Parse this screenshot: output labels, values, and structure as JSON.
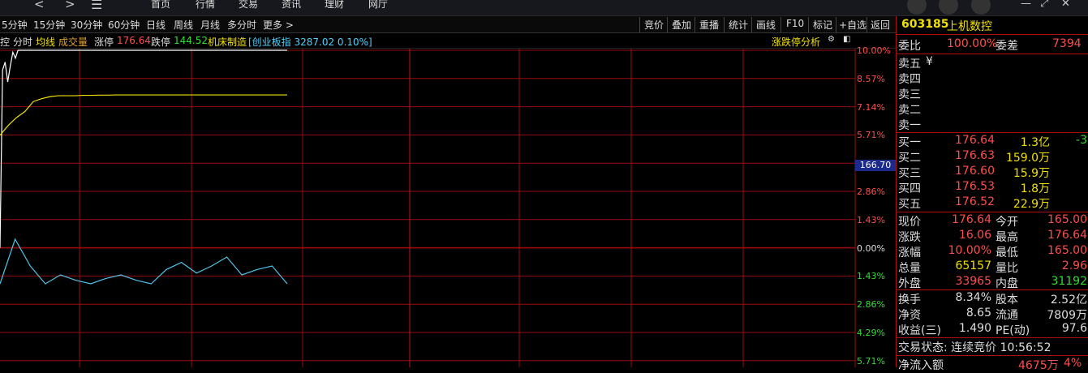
{
  "nav": {
    "back": "<",
    "forward": ">",
    "menu_icon": "menu-icon",
    "items": [
      "首页",
      "行情",
      "交易",
      "资讯",
      "理财",
      "网厅"
    ]
  },
  "periods": [
    "5分钟",
    "15分钟",
    "30分钟",
    "60分钟",
    "日线",
    "周线",
    "月线",
    "多分时",
    "更多 >"
  ],
  "tools": [
    "竞价",
    "叠加",
    "重播",
    "统计",
    "画线",
    "F10",
    "标记",
    "+自选",
    "返回"
  ],
  "subbar": {
    "prefix": "控",
    "fenshi": "分时",
    "avg": "均线",
    "vol": "成交量",
    "zt_label": "涨停",
    "zt_val": "176.64",
    "dt_label": "跌停",
    "dt_val": "144.52",
    "sector": "机床制造",
    "index_text": "[创业板指 3287.02 0.10%]",
    "analysis": "涨跌停分析"
  },
  "yaxis": [
    {
      "label": "10.00%",
      "color": "red"
    },
    {
      "label": "8.57%",
      "color": "red"
    },
    {
      "label": "7.14%",
      "color": "red"
    },
    {
      "label": "5.71%",
      "color": "red"
    },
    {
      "label": "",
      "color": "red"
    },
    {
      "label": "2.86%",
      "color": "red"
    },
    {
      "label": "1.43%",
      "color": "red"
    },
    {
      "label": "0.00%",
      "color": "white"
    },
    {
      "label": "1.43%",
      "color": "green"
    },
    {
      "label": "2.86%",
      "color": "green"
    },
    {
      "label": "4.29%",
      "color": "green"
    },
    {
      "label": "5.71%",
      "color": "green"
    }
  ],
  "current_price_tag": "166.70",
  "stock": {
    "code": "603185",
    "name": "上机数控"
  },
  "weibi": {
    "label": "委比",
    "value": "100.00%",
    "label2": "委差",
    "value2": "7394"
  },
  "asks": [
    {
      "label": "卖五",
      "price": "¥",
      "vol": ""
    },
    {
      "label": "卖四",
      "price": "",
      "vol": ""
    },
    {
      "label": "卖三",
      "price": "",
      "vol": ""
    },
    {
      "label": "卖二",
      "price": "",
      "vol": ""
    },
    {
      "label": "卖一",
      "price": "",
      "vol": ""
    }
  ],
  "bids": [
    {
      "label": "买一",
      "price": "176.64",
      "vol": "1.3亿",
      "extra": "-3"
    },
    {
      "label": "买二",
      "price": "176.63",
      "vol": "159.0万",
      "extra": ""
    },
    {
      "label": "买三",
      "price": "176.60",
      "vol": "15.9万",
      "extra": ""
    },
    {
      "label": "买四",
      "price": "176.53",
      "vol": "1.8万",
      "extra": ""
    },
    {
      "label": "买五",
      "price": "176.52",
      "vol": "22.9万",
      "extra": ""
    }
  ],
  "stats1": [
    {
      "l1": "现价",
      "v1": "176.64",
      "c1": "red",
      "l2": "今开",
      "v2": "165.00",
      "c2": "red"
    },
    {
      "l1": "涨跌",
      "v1": "16.06",
      "c1": "red",
      "l2": "最高",
      "v2": "176.64",
      "c2": "red"
    },
    {
      "l1": "涨幅",
      "v1": "10.00%",
      "c1": "red",
      "l2": "最低",
      "v2": "165.00",
      "c2": "red"
    },
    {
      "l1": "总量",
      "v1": "65157",
      "c1": "yel",
      "l2": "量比",
      "v2": "2.96",
      "c2": "red"
    },
    {
      "l1": "外盘",
      "v1": "33965",
      "c1": "red",
      "l2": "内盘",
      "v2": "31192",
      "c2": "grn"
    }
  ],
  "stats2": [
    {
      "l1": "换手",
      "v1": "8.34%",
      "l2": "股本",
      "v2": "2.52亿"
    },
    {
      "l1": "净资",
      "v1": "8.65",
      "l2": "流通",
      "v2": "7809万"
    },
    {
      "l1": "收益(三)",
      "v1": "1.490",
      "l2": "PE(动)",
      "v2": "97.6"
    }
  ],
  "trade_status": "交易状态: 连续竞价 10:56:52",
  "net_flow": {
    "label": "净流入额",
    "value": "4675万",
    "pct": "4%"
  },
  "colors": {
    "up": "#ff4d4d",
    "down": "#33dd33",
    "grid": "#9a0c0c",
    "avg": "#f0e000",
    "price": "#ffffff"
  },
  "chart_data": {
    "type": "line",
    "series": [
      {
        "values": [
          0.0,
          9.0,
          9.4,
          8.4,
          9.2,
          9.9,
          9.6,
          10.0,
          10.0,
          10.0,
          10.0,
          10.0,
          10.0,
          10.0,
          10.0,
          10.0,
          10.0,
          10.0,
          10.0,
          10.0
        ]
      },
      {
        "values": [
          5.7,
          6.2,
          6.6,
          6.9,
          7.4,
          7.55,
          7.65,
          7.7,
          7.7,
          7.7,
          7.72,
          7.72,
          7.73,
          7.73,
          7.74,
          7.74,
          7.74,
          7.74,
          7.74,
          7.74
        ]
      },
      {
        "values": [
          0.0,
          0.25,
          0.1,
          0.0,
          0.05,
          0.02,
          0.0,
          0.03,
          0.05,
          0.02,
          0.0,
          0.08,
          0.12,
          0.06,
          0.1,
          0.15,
          0.05,
          0.08,
          0.1,
          0.0
        ]
      }
    ],
    "ylim": [
      -5.71,
      10.0
    ]
  }
}
